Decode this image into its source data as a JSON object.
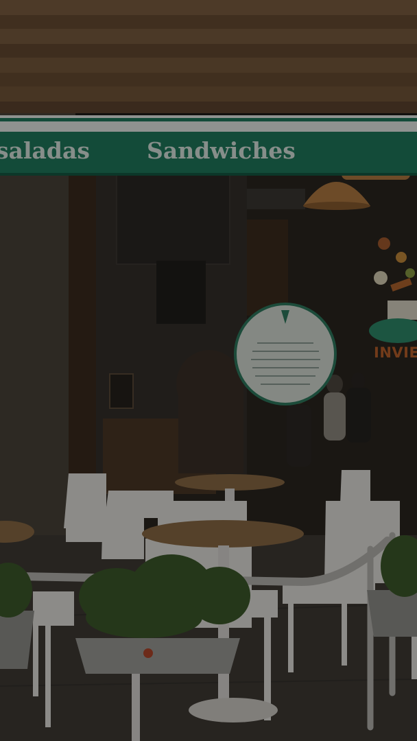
{
  "awning": {
    "left_text": "saladas",
    "right_text": "Sandwiches",
    "color": "#1f7a5c"
  },
  "window_sign": {
    "partial_text": "INVIE"
  },
  "colors": {
    "wood": "#7a5a3c",
    "awning_green": "#1f7a5c",
    "chair_white": "#e9e7e3",
    "table_wood": "#8a6a45",
    "plant_green": "#3d5a2a"
  }
}
